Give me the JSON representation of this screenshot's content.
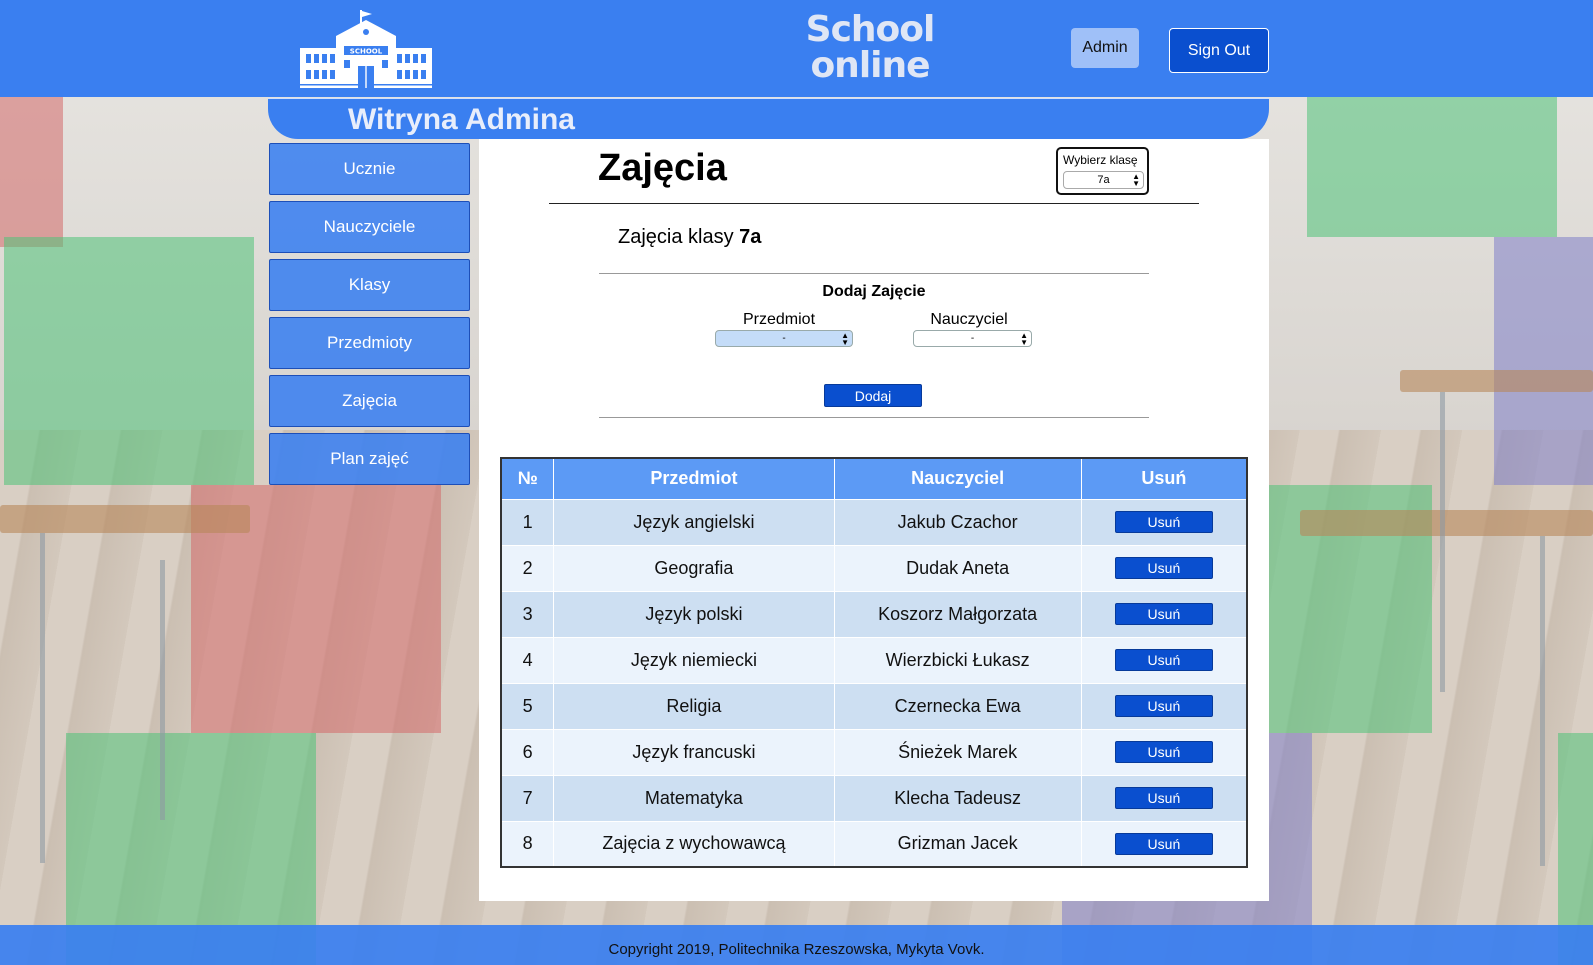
{
  "header": {
    "brand_line1": "School",
    "brand_line2": "online",
    "logo_sign": "SCHOOL",
    "admin_label": "Admin",
    "signout_label": "Sign Out"
  },
  "banner": {
    "title": "Witryna Admina"
  },
  "sidebar": {
    "items": [
      {
        "label": "Ucznie"
      },
      {
        "label": "Nauczyciele"
      },
      {
        "label": "Klasy"
      },
      {
        "label": "Przedmioty"
      },
      {
        "label": "Zajęcia"
      },
      {
        "label": "Plan zajęć"
      }
    ]
  },
  "main": {
    "title": "Zajęcia",
    "class_picker": {
      "label": "Wybierz klasę",
      "selected": "7a"
    },
    "subtitle_prefix": "Zajęcia klasy",
    "subtitle_class": "7a",
    "add_form": {
      "heading": "Dodaj Zajęcie",
      "subject_label": "Przedmiot",
      "subject_value": "-",
      "teacher_label": "Nauczyciel",
      "teacher_value": "-",
      "submit_label": "Dodaj"
    },
    "table": {
      "headers": [
        "№",
        "Przedmiot",
        "Nauczyciel",
        "Usuń"
      ],
      "delete_label": "Usuń",
      "rows": [
        {
          "no": "1",
          "subject": "Język angielski",
          "teacher": "Jakub Czachor"
        },
        {
          "no": "2",
          "subject": "Geografia",
          "teacher": "Dudak Aneta"
        },
        {
          "no": "3",
          "subject": "Język polski",
          "teacher": "Koszorz Małgorzata"
        },
        {
          "no": "4",
          "subject": "Język niemiecki",
          "teacher": "Wierzbicki Łukasz"
        },
        {
          "no": "5",
          "subject": "Religia",
          "teacher": "Czernecka Ewa"
        },
        {
          "no": "6",
          "subject": "Język francuski",
          "teacher": "Śnieżek Marek"
        },
        {
          "no": "7",
          "subject": "Matematyka",
          "teacher": "Klecha Tadeusz"
        },
        {
          "no": "8",
          "subject": "Zajęcia z wychowawcą",
          "teacher": "Grizman Jacek"
        }
      ]
    }
  },
  "footer": {
    "text": "Copyright 2019, Politechnika Rzeszowska, Mykyta Vovk."
  },
  "colors": {
    "header_blue": "#3a7ff0",
    "button_blue": "#0a4fcf",
    "table_header": "#5c9af5",
    "row_odd": "#cddff2",
    "row_even": "#ebf3fc"
  }
}
